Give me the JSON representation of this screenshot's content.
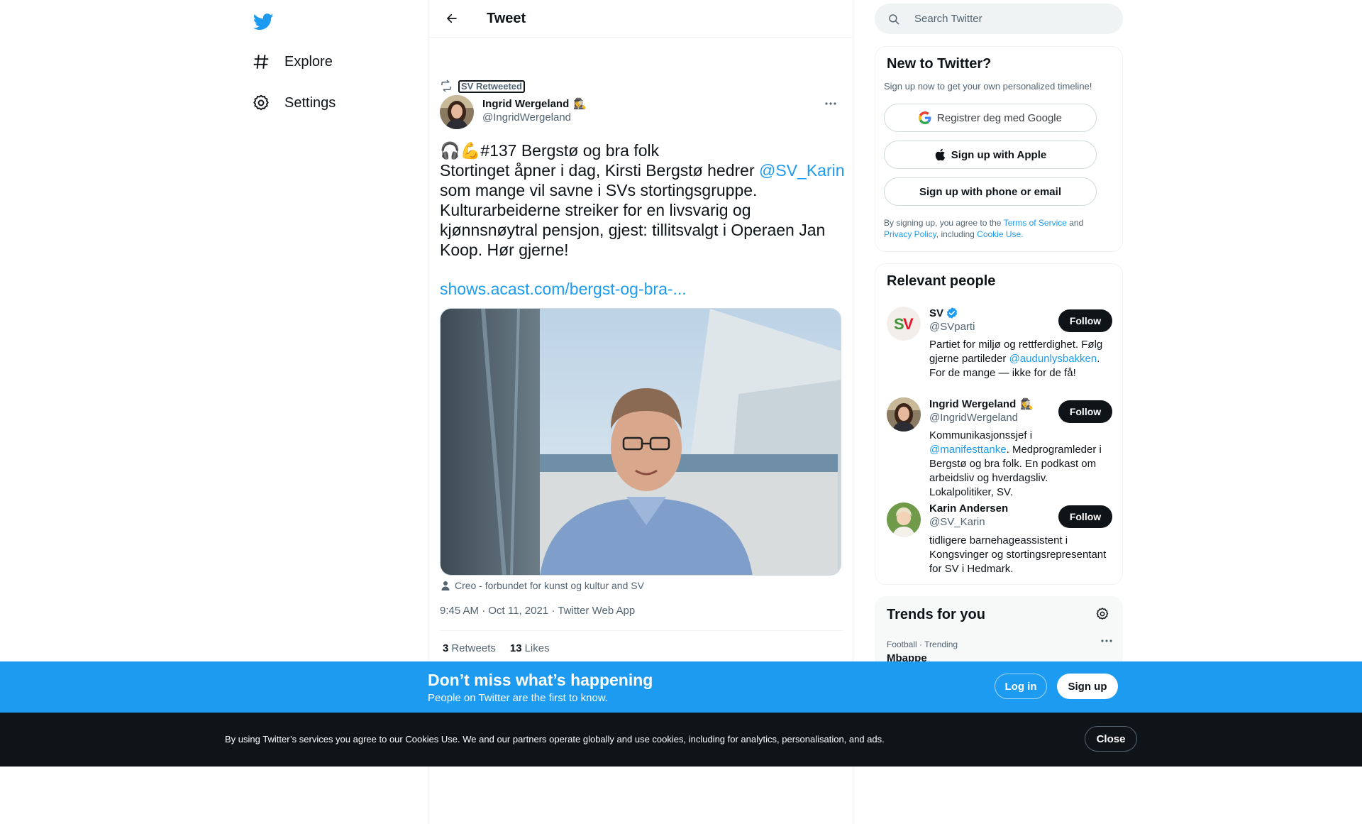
{
  "nav": {
    "items": [
      {
        "label": "Explore",
        "icon": "hashtag-icon"
      },
      {
        "label": "Settings",
        "icon": "gear-icon"
      }
    ]
  },
  "header": {
    "title": "Tweet"
  },
  "tweet": {
    "retweeted_by": "SV Retweeted",
    "author_name": "Ingrid Wergeland",
    "author_emoji": "🕵️‍♀️",
    "author_handle": "@IngridWergeland",
    "text_line1": "🎧💪#137 Bergstø og bra folk",
    "text_line2_pre": "Stortinget åpner i dag, Kirsti Bergstø hedrer ",
    "text_line2_mention": "@SV_Karin",
    "text_line3": "som mange vil savne i SVs stortingsgruppe.",
    "text_line4": "Kulturarbeiderne streiker for en livsvarig og",
    "text_line5": "kjønnsnøytral pensjon, gjest: tillitsvalgt i Operaen Jan",
    "text_line6": "Koop. Hør gjerne!",
    "link": "shows.acast.com/bergst-og-bra-...",
    "media_tags": "Creo - forbundet for kunst og kultur and SV",
    "time": "9:45 AM",
    "date": "Oct 11, 2021",
    "source": "Twitter Web App",
    "retweets_count": "3",
    "retweets_label": "Retweets",
    "likes_count": "13",
    "likes_label": "Likes"
  },
  "search": {
    "placeholder": "Search Twitter"
  },
  "new_to_twitter": {
    "title": "New to Twitter?",
    "subtitle": "Sign up now to get your own personalized timeline!",
    "google_label": "Registrer deg med Google",
    "apple_label": "Sign up with Apple",
    "phone_label": "Sign up with phone or email",
    "terms_pre": "By signing up, you agree to the ",
    "terms_link": "Terms of Service",
    "terms_and": " and",
    "privacy_link": "Privacy Policy",
    "terms_including": ", including ",
    "cookie_link": "Cookie Use."
  },
  "relevant_people": {
    "title": "Relevant people",
    "follow_label": "Follow",
    "people": [
      {
        "name": "SV",
        "handle": "@SVparti",
        "bio_pre": "Partiet for miljø og rettferdighet. Følg gjerne partileder ",
        "bio_mention": "@audunlysbakken",
        "bio_post": ". For de mange — ikke for de få!"
      },
      {
        "name": "Ingrid Wergeland",
        "emoji": "🕵️‍♀️",
        "handle": "@IngridWergeland",
        "bio_pre": "Kommunikasjonssjef i ",
        "bio_mention": "@manifesttanke",
        "bio_post": ". Medprogramleder i Bergstø og bra folk. En podkast om arbeidsliv og hverdagsliv. Lokalpolitiker, SV."
      },
      {
        "name": "Karin Andersen",
        "handle": "@SV_Karin",
        "bio": "tidligere barnehageassistent i Kongsvinger og stortingsrepresentant for SV i Hedmark."
      }
    ]
  },
  "trends": {
    "title": "Trends for you",
    "items": [
      {
        "context": "Football · Trending",
        "name": "Mbappe"
      }
    ]
  },
  "login_bar": {
    "title": "Don’t miss what’s happening",
    "subtitle": "People on Twitter are the first to know.",
    "login_label": "Log in",
    "signup_label": "Sign up"
  },
  "cookie_bar": {
    "text": "By using Twitter’s services you agree to our Cookies Use. We and our partners operate globally and use cookies, including for analytics, personalisation, and ads.",
    "close_label": "Close"
  },
  "colors": {
    "accent": "#1d9bf0",
    "text": "#0f1419",
    "muted": "#536471",
    "cookie_bg": "#0f1419"
  }
}
